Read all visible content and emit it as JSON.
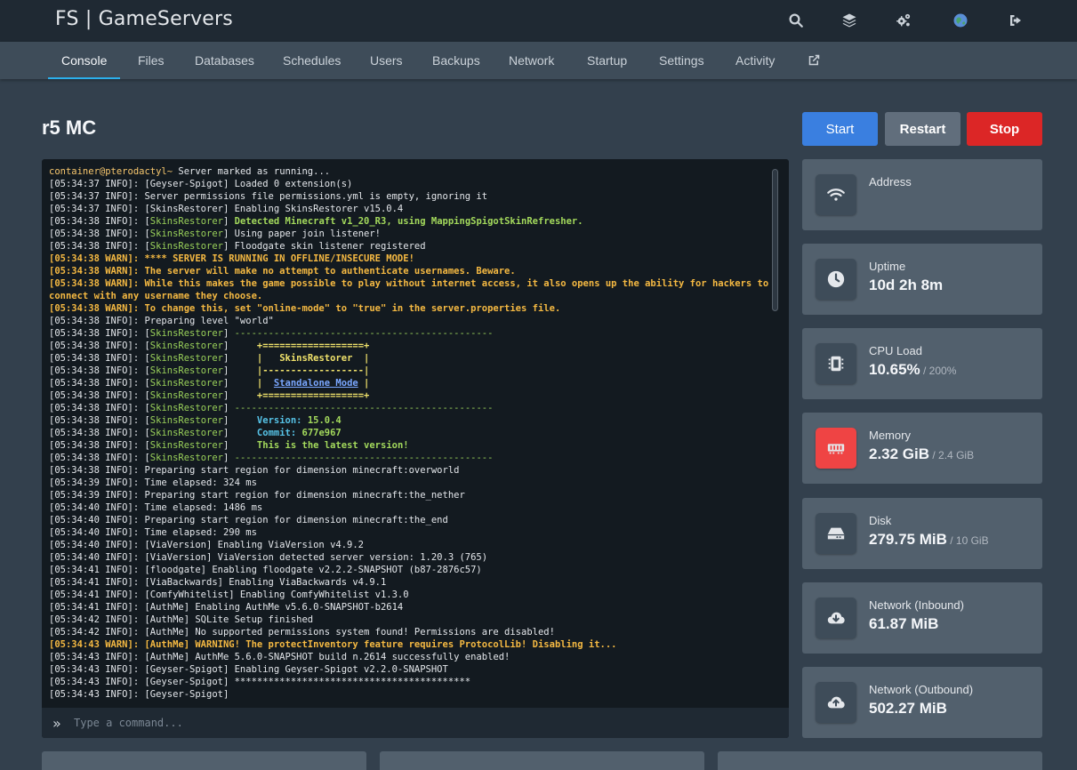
{
  "app": {
    "title": "FS | GameServers"
  },
  "topbar": {
    "icons": [
      "search-icon",
      "layers-icon",
      "cogs-icon",
      "avatar",
      "sign-out-icon"
    ]
  },
  "nav": {
    "tabs": [
      {
        "label": "Console",
        "active": true
      },
      {
        "label": "Files"
      },
      {
        "label": "Databases"
      },
      {
        "label": "Schedules"
      },
      {
        "label": "Users"
      },
      {
        "label": "Backups"
      },
      {
        "label": "Network"
      },
      {
        "label": "Startup"
      },
      {
        "label": "Settings"
      },
      {
        "label": "Activity"
      }
    ],
    "external_icon": "external-link-icon"
  },
  "server": {
    "name": "r5 MC"
  },
  "power": {
    "start": "Start",
    "restart": "Restart",
    "stop": "Stop"
  },
  "colors": {
    "accent": "#3a7fe0",
    "stop": "#dc2626",
    "warn": "#f5b942",
    "memory_alert": "#ef4444"
  },
  "console": {
    "placeholder": "Type a command...",
    "lines": [
      [
        [
          "container@pterodactyl~ ",
          "prompt"
        ],
        [
          "Server marked as running...",
          ""
        ]
      ],
      [
        [
          "[05:34:37 INFO]: [Geyser-Spigot] Loaded 0 extension(s)",
          ""
        ]
      ],
      [
        [
          "[05:34:37 INFO]: Server permissions file permissions.yml is empty, ignoring it",
          ""
        ]
      ],
      [
        [
          "[05:34:37 INFO]: [SkinsRestorer] Enabling SkinsRestorer v15.0.4",
          ""
        ]
      ],
      [
        [
          "[05:34:38 INFO]: [",
          ""
        ],
        [
          "SkinsRestorer",
          "green"
        ],
        [
          "] ",
          ""
        ],
        [
          "Detected Minecraft v1_20_R3, using MappingSpigotSkinRefresher.",
          "green-b"
        ]
      ],
      [
        [
          "[05:34:38 INFO]: [",
          ""
        ],
        [
          "SkinsRestorer",
          "green"
        ],
        [
          "] Using paper join listener!",
          ""
        ]
      ],
      [
        [
          "[05:34:38 INFO]: [",
          ""
        ],
        [
          "SkinsRestorer",
          "green"
        ],
        [
          "] Floodgate skin listener registered",
          ""
        ]
      ],
      [
        [
          "[05:34:38 WARN]: **** SERVER IS RUNNING IN OFFLINE/INSECURE MODE!",
          "warn"
        ]
      ],
      [
        [
          "[05:34:38 WARN]: The server will make no attempt to authenticate usernames. Beware.",
          "warn"
        ]
      ],
      [
        [
          "[05:34:38 WARN]: While this makes the game possible to play without internet access, it also opens up the ability for hackers to connect with any username they choose.",
          "warn"
        ]
      ],
      [
        [
          "[05:34:38 WARN]: To change this, set \"online-mode\" to \"true\" in the server.properties file.",
          "warn"
        ]
      ],
      [
        [
          "[05:34:38 INFO]: Preparing level \"world\"",
          ""
        ]
      ],
      [
        [
          "[05:34:38 INFO]: [",
          ""
        ],
        [
          "SkinsRestorer",
          "green"
        ],
        [
          "] ",
          ""
        ],
        [
          "----------------------------------------------",
          "green"
        ]
      ],
      [
        [
          "[05:34:38 INFO]: [",
          ""
        ],
        [
          "SkinsRestorer",
          "green"
        ],
        [
          "]     ",
          ""
        ],
        [
          "+==================+",
          "yellow-b"
        ]
      ],
      [
        [
          "[05:34:38 INFO]: [",
          ""
        ],
        [
          "SkinsRestorer",
          "green"
        ],
        [
          "]     ",
          ""
        ],
        [
          "|   SkinsRestorer  |",
          "yellow-b"
        ]
      ],
      [
        [
          "[05:34:38 INFO]: [",
          ""
        ],
        [
          "SkinsRestorer",
          "green"
        ],
        [
          "]     ",
          ""
        ],
        [
          "|------------------|",
          "yellow-b"
        ]
      ],
      [
        [
          "[05:34:38 INFO]: [",
          ""
        ],
        [
          "SkinsRestorer",
          "green"
        ],
        [
          "]     ",
          ""
        ],
        [
          "|  ",
          "yellow-b"
        ],
        [
          "Standalone Mode",
          "link"
        ],
        [
          " |",
          "yellow-b"
        ]
      ],
      [
        [
          "[05:34:38 INFO]: [",
          ""
        ],
        [
          "SkinsRestorer",
          "green"
        ],
        [
          "]     ",
          ""
        ],
        [
          "+==================+",
          "yellow-b"
        ]
      ],
      [
        [
          "[05:34:38 INFO]: [",
          ""
        ],
        [
          "SkinsRestorer",
          "green"
        ],
        [
          "] ",
          ""
        ],
        [
          "----------------------------------------------",
          "green"
        ]
      ],
      [
        [
          "[05:34:38 INFO]: [",
          ""
        ],
        [
          "SkinsRestorer",
          "green"
        ],
        [
          "]     ",
          ""
        ],
        [
          "Version: ",
          "cyan-b"
        ],
        [
          "15.0.4",
          "green-b"
        ]
      ],
      [
        [
          "[05:34:38 INFO]: [",
          ""
        ],
        [
          "SkinsRestorer",
          "green"
        ],
        [
          "]     ",
          ""
        ],
        [
          "Commit: ",
          "cyan-b"
        ],
        [
          "677e967",
          "green-b"
        ]
      ],
      [
        [
          "[05:34:38 INFO]: [",
          ""
        ],
        [
          "SkinsRestorer",
          "green"
        ],
        [
          "]     ",
          ""
        ],
        [
          "This is the latest version!",
          "green-b"
        ]
      ],
      [
        [
          "[05:34:38 INFO]: [",
          ""
        ],
        [
          "SkinsRestorer",
          "green"
        ],
        [
          "] ",
          ""
        ],
        [
          "----------------------------------------------",
          "green"
        ]
      ],
      [
        [
          "[05:34:38 INFO]: Preparing start region for dimension minecraft:overworld",
          ""
        ]
      ],
      [
        [
          "[05:34:39 INFO]: Time elapsed: 324 ms",
          ""
        ]
      ],
      [
        [
          "[05:34:39 INFO]: Preparing start region for dimension minecraft:the_nether",
          ""
        ]
      ],
      [
        [
          "[05:34:40 INFO]: Time elapsed: 1486 ms",
          ""
        ]
      ],
      [
        [
          "[05:34:40 INFO]: Preparing start region for dimension minecraft:the_end",
          ""
        ]
      ],
      [
        [
          "[05:34:40 INFO]: Time elapsed: 290 ms",
          ""
        ]
      ],
      [
        [
          "[05:34:40 INFO]: [ViaVersion] Enabling ViaVersion v4.9.2",
          ""
        ]
      ],
      [
        [
          "[05:34:40 INFO]: [ViaVersion] ViaVersion detected server version: 1.20.3 (765)",
          ""
        ]
      ],
      [
        [
          "[05:34:41 INFO]: [floodgate] Enabling floodgate v2.2.2-SNAPSHOT (b87-2876c57)",
          ""
        ]
      ],
      [
        [
          "[05:34:41 INFO]: [ViaBackwards] Enabling ViaBackwards v4.9.1",
          ""
        ]
      ],
      [
        [
          "[05:34:41 INFO]: [ComfyWhitelist] Enabling ComfyWhitelist v1.3.0",
          ""
        ]
      ],
      [
        [
          "[05:34:41 INFO]: [AuthMe] Enabling AuthMe v5.6.0-SNAPSHOT-b2614",
          ""
        ]
      ],
      [
        [
          "[05:34:42 INFO]: [AuthMe] SQLite Setup finished",
          ""
        ]
      ],
      [
        [
          "[05:34:42 INFO]: [AuthMe] No supported permissions system found! Permissions are disabled!",
          ""
        ]
      ],
      [
        [
          "[05:34:43 WARN]: [AuthMe] WARNING! The protectInventory feature requires ProtocolLib! Disabling it...",
          "warn"
        ]
      ],
      [
        [
          "[05:34:43 INFO]: [AuthMe] AuthMe 5.6.0-SNAPSHOT build n.2614 successfully enabled!",
          ""
        ]
      ],
      [
        [
          "[05:34:43 INFO]: [Geyser-Spigot] Enabling Geyser-Spigot v2.2.0-SNAPSHOT",
          ""
        ]
      ],
      [
        [
          "[05:34:43 INFO]: [Geyser-Spigot] ******************************************",
          ""
        ]
      ],
      [
        [
          "[05:34:43 INFO]: [Geyser-Spigot]",
          ""
        ]
      ]
    ]
  },
  "stats": [
    {
      "label": "Address",
      "value": "",
      "sub": "",
      "icon": "wifi-icon"
    },
    {
      "label": "Uptime",
      "value": "10d 2h 8m",
      "sub": "",
      "icon": "clock-icon"
    },
    {
      "label": "CPU Load",
      "value": "10.65%",
      "sub": " / 200%",
      "icon": "cpu-icon"
    },
    {
      "label": "Memory",
      "value": "2.32 GiB",
      "sub": " / 2.4 GiB",
      "icon": "memory-icon",
      "alert": true
    },
    {
      "label": "Disk",
      "value": "279.75 MiB",
      "sub": " / 10 GiB",
      "icon": "hdd-icon"
    },
    {
      "label": "Network (Inbound)",
      "value": "61.87 MiB",
      "sub": "",
      "icon": "cloud-download-icon"
    },
    {
      "label": "Network (Outbound)",
      "value": "502.27 MiB",
      "sub": "",
      "icon": "cloud-upload-icon"
    }
  ]
}
